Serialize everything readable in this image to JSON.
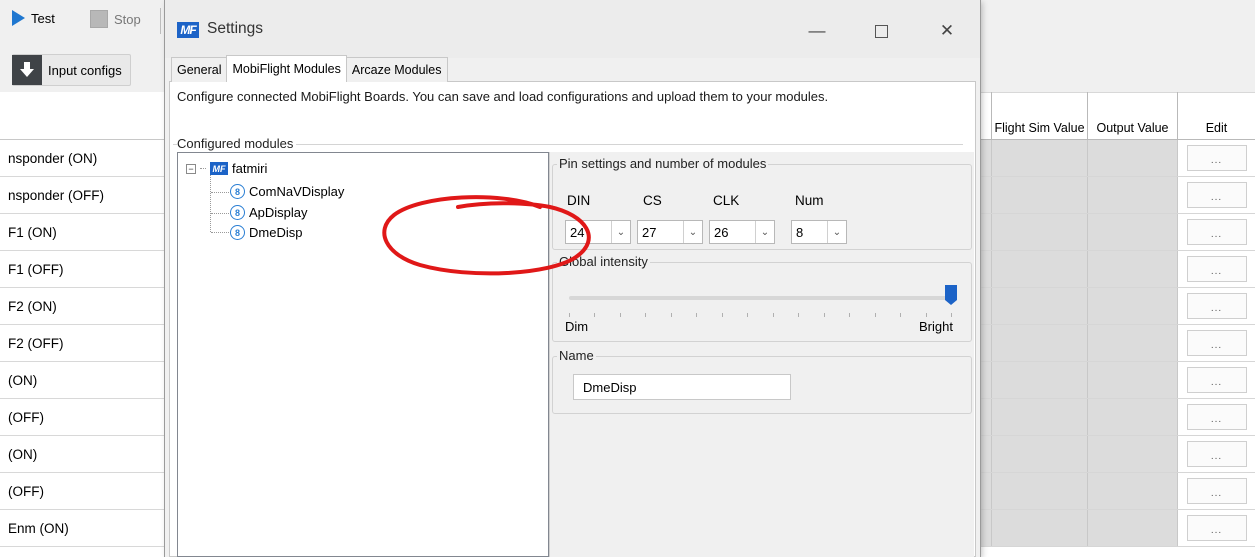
{
  "toolbar": {
    "test_label": "Test",
    "stop_label": "Stop",
    "input_configs_label": "Input configs"
  },
  "left_list": {
    "rows": [
      "nsponder (ON)",
      "nsponder (OFF)",
      "F1 (ON)",
      "F1 (OFF)",
      "F2 (ON)",
      "F2 (OFF)",
      "(ON)",
      "(OFF)",
      "(ON)",
      "(OFF)",
      "Enm (ON)"
    ]
  },
  "grid": {
    "headers": {
      "flight_sim_value": "Flight Sim Value",
      "output_value": "Output Value",
      "edit": "Edit"
    },
    "edit_button_label": "...",
    "row_count": 11
  },
  "dialog": {
    "title": "Settings",
    "logo_text": "MF",
    "tabs": [
      "General",
      "MobiFlight Modules",
      "Arcaze Modules"
    ],
    "active_tab": "MobiFlight Modules",
    "description": "Configure connected MobiFlight Boards. You can save and load configurations and upload them to your modules.",
    "configured_modules_label": "Configured modules",
    "tree": {
      "board": {
        "name": "fatmiri",
        "icon": "mobiflight-board-icon",
        "expander": "−"
      },
      "modules": [
        {
          "name": "ComNaVDisplay",
          "icon": "led-module-icon"
        },
        {
          "name": "ApDisplay",
          "icon": "led-module-icon"
        },
        {
          "name": "DmeDisp",
          "icon": "led-module-icon"
        }
      ]
    },
    "pin_settings": {
      "group_title": "Pin settings and number of modules",
      "din": {
        "label": "DIN",
        "value": "24"
      },
      "cs": {
        "label": "CS",
        "value": "27"
      },
      "clk": {
        "label": "CLK",
        "value": "26"
      },
      "num": {
        "label": "Num",
        "value": "8"
      }
    },
    "global_intensity": {
      "group_title": "Global intensity",
      "min_label": "Dim",
      "max_label": "Bright",
      "level": 1.0
    },
    "name": {
      "group_title": "Name",
      "value": "DmeDisp"
    }
  },
  "colors": {
    "accent": "#1c63c7",
    "annotation": "#e01818",
    "grid_cell": "#dcdcdc"
  }
}
